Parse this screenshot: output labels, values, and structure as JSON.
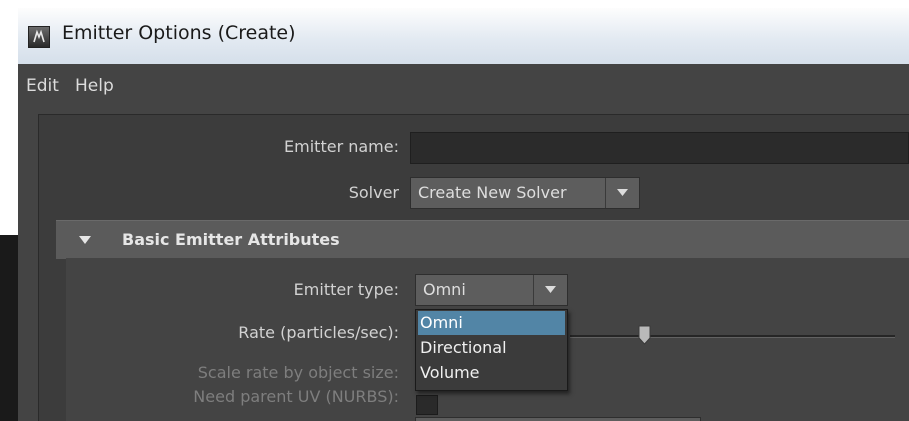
{
  "window": {
    "title": "Emitter Options (Create)"
  },
  "menu": {
    "items": [
      "Edit",
      "Help"
    ]
  },
  "form": {
    "emitter_name_label": "Emitter name:",
    "emitter_name_value": "",
    "solver_label": "Solver",
    "solver_value": "Create New Solver"
  },
  "section": {
    "title": "Basic Emitter Attributes",
    "expanded": true,
    "emitter_type_label": "Emitter type:",
    "emitter_type_value": "Omni",
    "rate_label": "Rate (particles/sec):",
    "scale_rate_label": "Scale rate by object size:",
    "need_parent_uv_label": "Need parent UV (NURBS):"
  },
  "dropdown": {
    "options": [
      "Omni",
      "Directional",
      "Volume"
    ],
    "selected": "Omni"
  },
  "colors": {
    "panel_bg": "#444444",
    "section_header_bg": "#5b5b5b",
    "highlight": "#5285a6",
    "titlebar": "#e3eaf2"
  },
  "icons": {
    "app": "maya-app-icon",
    "section_toggle": "triangle-down-icon",
    "combo_arrow": "chevron-down-icon"
  }
}
